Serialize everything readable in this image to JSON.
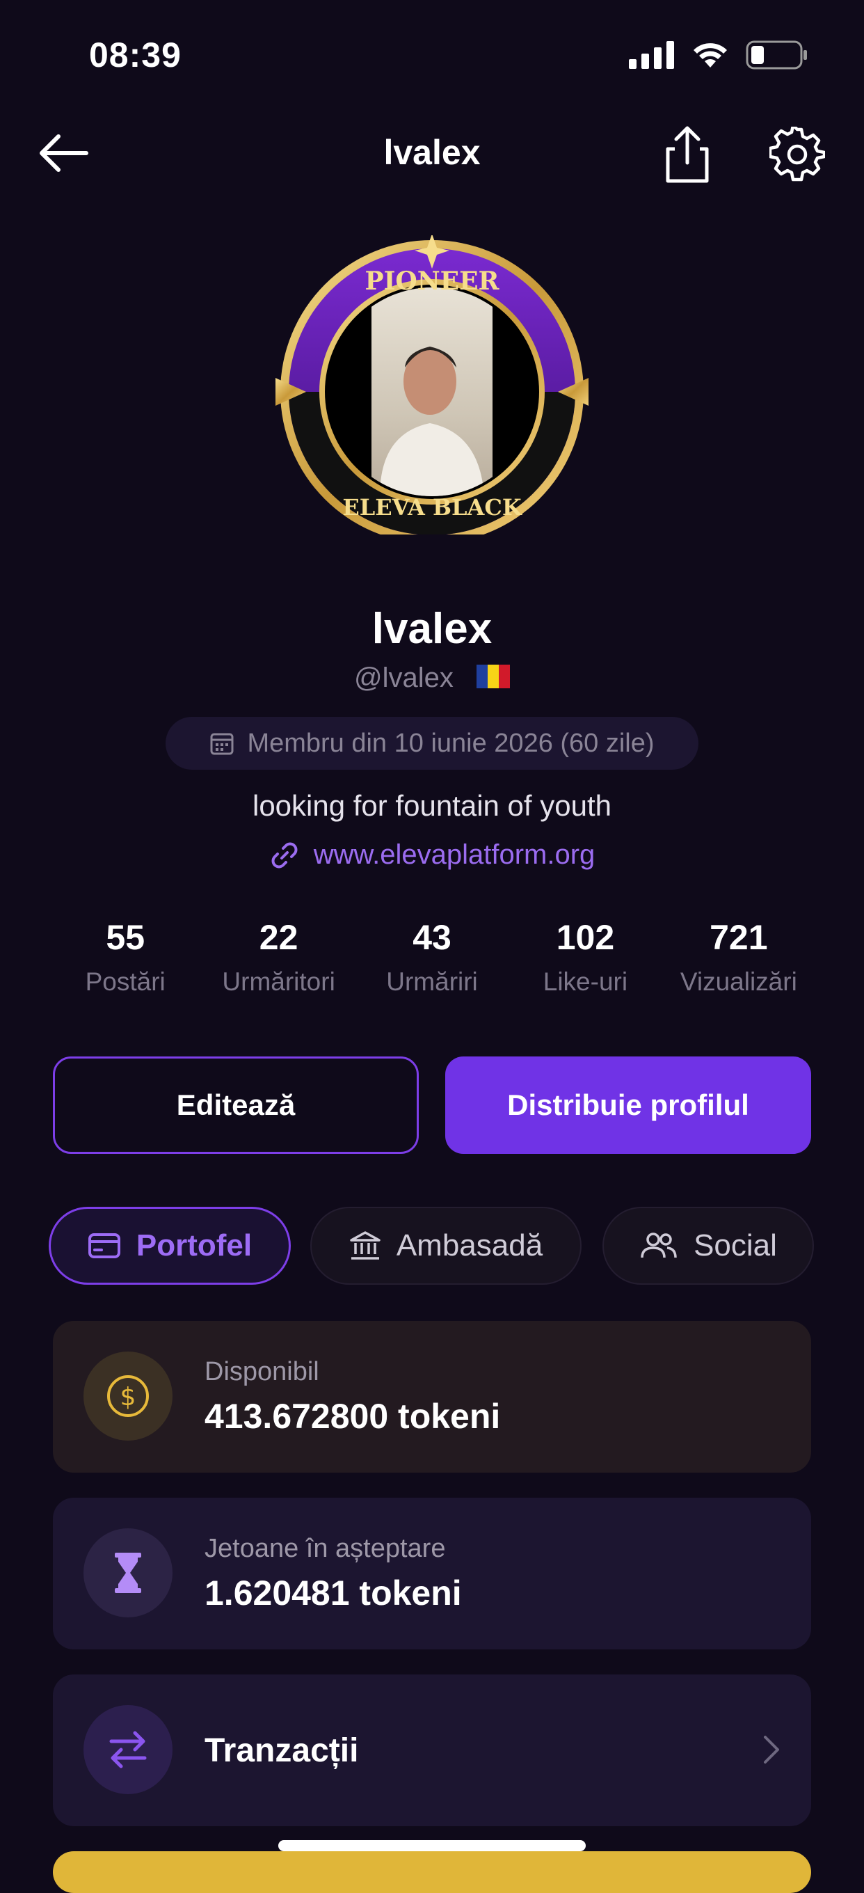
{
  "status_bar": {
    "time": "08:39"
  },
  "header": {
    "title": "lvalex"
  },
  "badge": {
    "top_text": "PIONEER",
    "bottom_text": "ELEVA BLACK"
  },
  "profile": {
    "name": "lvalex",
    "handle": "@lvalex",
    "member_since": "Membru din 10 iunie 2026 (60 zile)",
    "bio": "looking for fountain of youth",
    "website": "www.elevaplatform.org"
  },
  "stats": [
    {
      "value": "55",
      "label": "Postări"
    },
    {
      "value": "22",
      "label": "Urmăritori"
    },
    {
      "value": "43",
      "label": "Urmăriri"
    },
    {
      "value": "102",
      "label": "Like-uri"
    },
    {
      "value": "721",
      "label": "Vizualizări"
    }
  ],
  "buttons": {
    "edit": "Editează",
    "share": "Distribuie profilul"
  },
  "tabs": [
    {
      "label": "Portofel",
      "icon": "wallet-icon",
      "active": true
    },
    {
      "label": "Ambasadă",
      "icon": "bank-icon",
      "active": false
    },
    {
      "label": "Social",
      "icon": "people-icon",
      "active": false
    }
  ],
  "wallet": {
    "available_label": "Disponibil",
    "available_value": "413.672800 tokeni",
    "pending_label": "Jetoane în așteptare",
    "pending_value": "1.620481 tokeni",
    "transactions_label": "Tranzacții"
  },
  "colors": {
    "accent": "#7033e6",
    "background": "#0f0a1a",
    "gold": "#e0b639"
  }
}
